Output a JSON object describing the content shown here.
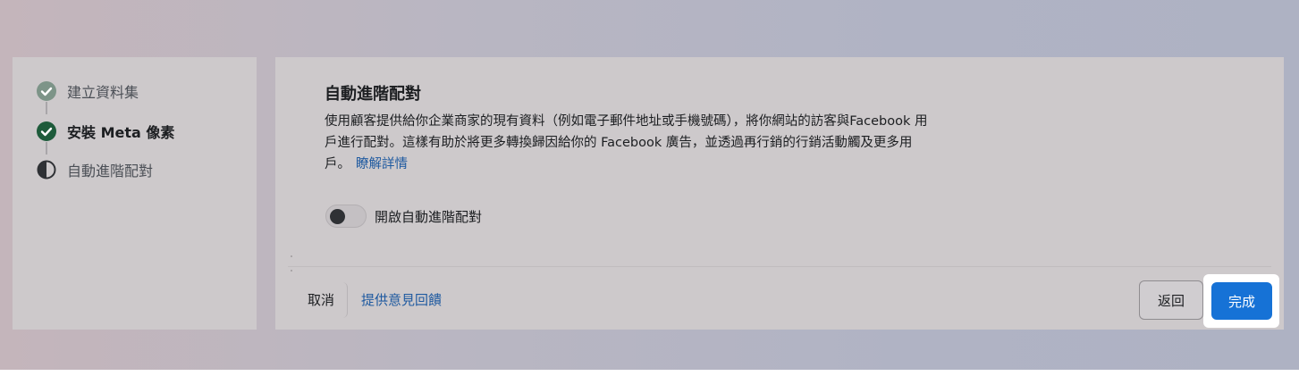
{
  "stepper": {
    "steps": [
      {
        "label": "建立資料集",
        "state": "completed",
        "icon": "check-circle-icon"
      },
      {
        "label": "安裝 Meta 像素",
        "state": "completed-current",
        "icon": "check-circle-icon"
      },
      {
        "label": "自動進階配對",
        "state": "in-progress",
        "icon": "half-circle-icon"
      }
    ]
  },
  "main": {
    "title": "自動進階配對",
    "description": "使用顧客提供給你企業商家的現有資料（例如電子郵件地址或手機號碼），將你網站的訪客與Facebook 用戶進行配對。這樣有助於將更多轉換歸因給你的 Facebook 廣告，並透過再行銷的行銷活動觸及更多用戶。",
    "learn_more_label": "瞭解詳情",
    "toggle": {
      "label": "開啟自動進階配對",
      "enabled": false
    }
  },
  "footer": {
    "cancel_label": "取消",
    "feedback_label": "提供意見回饋",
    "back_label": "返回",
    "done_label": "完成"
  },
  "colors": {
    "primary": "#1672d6",
    "link": "#1f5aa0",
    "check_dark": "#1e5b3b",
    "check_light": "#6e8b7b"
  }
}
